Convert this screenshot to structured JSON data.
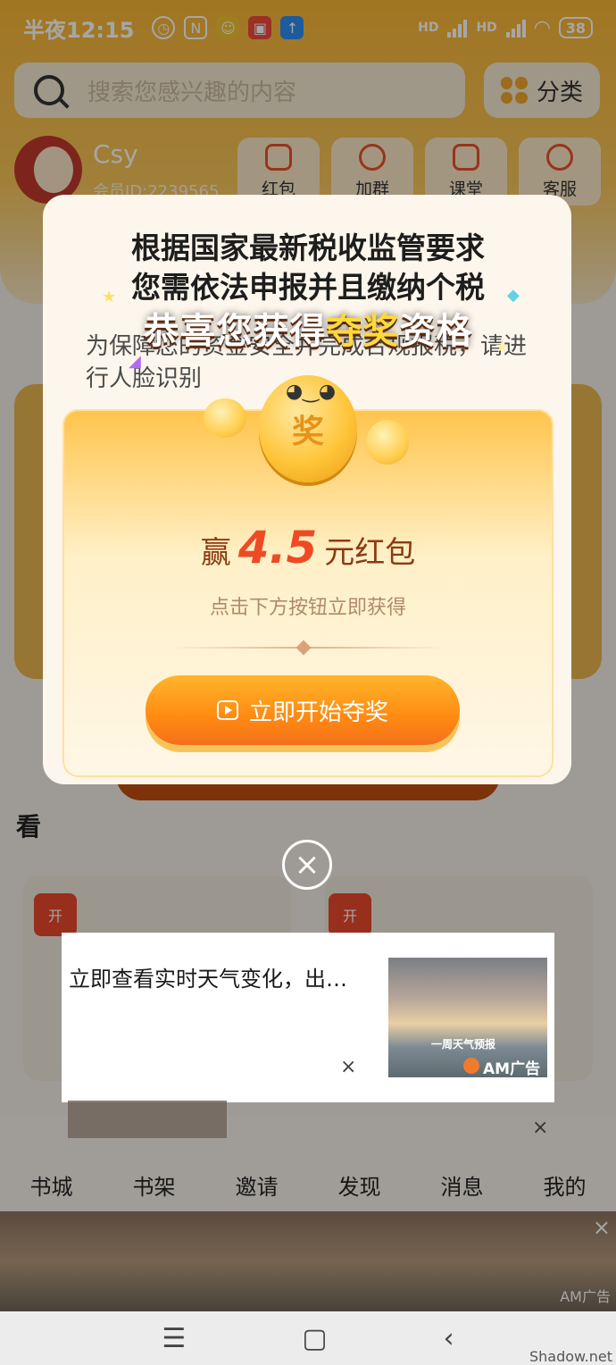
{
  "status_bar": {
    "time": "半夜12:15",
    "network_1": "HD",
    "network_2": "HD",
    "battery": "38"
  },
  "search": {
    "placeholder": "搜索您感兴趣的内容"
  },
  "category_button": "分类",
  "user": {
    "name": "Csy",
    "member_id": "会员ID:2239565"
  },
  "quick_actions": [
    "红包",
    "加群",
    "课堂",
    "客服"
  ],
  "tax_notice": {
    "title_line1": "根据国家最新税收监管要求",
    "title_line2": "您需依法申报并且缴纳个税",
    "body": "为保障您的资金安全并完成合规报税，请进行人脸识别"
  },
  "lottery_popup": {
    "banner_part1": "恭喜您获得",
    "banner_highlight": "夺奖",
    "banner_part2": "资格",
    "coin_label": "奖",
    "win_prefix": "赢",
    "win_amount": "4.5",
    "win_suffix": "元红包",
    "hint": "点击下方按钮立即获得",
    "button_label": "立即开始夺奖"
  },
  "section_title": "看",
  "book_badges": [
    "开",
    "开"
  ],
  "weather_ad": {
    "text": "立即查看实时天气变化，出…",
    "image_caption": "一周天气预报",
    "brand": "AM广告",
    "close": "×"
  },
  "tab_bar": [
    "书城",
    "书架",
    "邀请",
    "发现",
    "消息",
    "我的"
  ],
  "bottom_ad": {
    "brand": "AM广告",
    "close": "×"
  },
  "nav_bar": {
    "watermark": "Shadow.net"
  },
  "colors": {
    "accent_orange": "#ff8a12",
    "amount_red": "#ef4a23",
    "banner_yellow": "#ffd93a",
    "header_gold": "#f7b535"
  }
}
